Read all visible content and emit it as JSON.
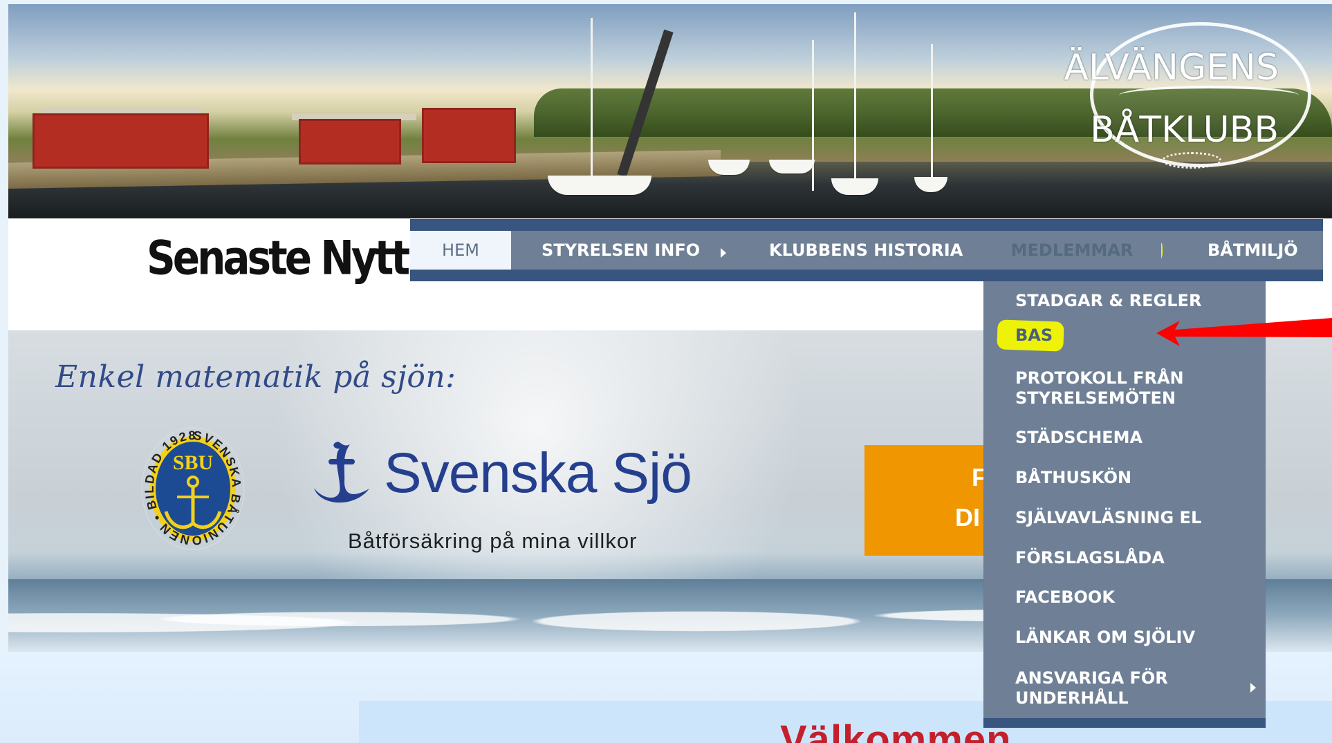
{
  "header": {
    "logo_lines": [
      "ÄLVÄNGENS",
      "BÅTKLUBB"
    ],
    "senaste_nytt": "Senaste Nytt"
  },
  "nav": {
    "items": [
      {
        "label": "HEM"
      },
      {
        "label": "STYRELSEN INFO"
      },
      {
        "label": "KLUBBENS HISTORIA"
      },
      {
        "label": "MEDLEMMAR"
      },
      {
        "label": "BÅTMILJÖ"
      }
    ],
    "active": "MEDLEMMAR"
  },
  "dropdown": {
    "items": [
      "STADGAR & REGLER",
      "BAS",
      "PROTOKOLL FRÅN STYRELSEMÖTEN",
      "STÄDSCHEMA",
      "BÅTHUSKÖN",
      "SJÄLVAVLÄSNING EL",
      "FÖRSLAGSLÅDA",
      "FACEBOOK",
      "LÄNKAR OM SJÖLIV",
      "ANSVARIGA FÖR UNDERHÅLL"
    ],
    "highlighted": "BAS"
  },
  "hero": {
    "tagline": "Enkel matematik på sjön:",
    "sbu_abbrev": "SBU",
    "sbu_ring_text": "SVENSKA BÅTUNIONEN • BILDAD 1928 •",
    "svenska_sjo": "Svenska Sjö",
    "subtitle": "Båtförsäkring på mina villkor",
    "orange_lines": [
      "F",
      "DI"
    ]
  },
  "content": {
    "welcome_partial": "Välkommen"
  },
  "colors": {
    "nav_dark": "#37557f",
    "nav_mid": "#6f8096",
    "highlight": "#eef108",
    "annotation_arrow": "#ff0000",
    "orange": "#ef9600",
    "welcome_red": "#c3202c"
  },
  "icons": {
    "dropdown_arrow": "caret-right-icon",
    "annotation": "red-arrow-icon"
  }
}
